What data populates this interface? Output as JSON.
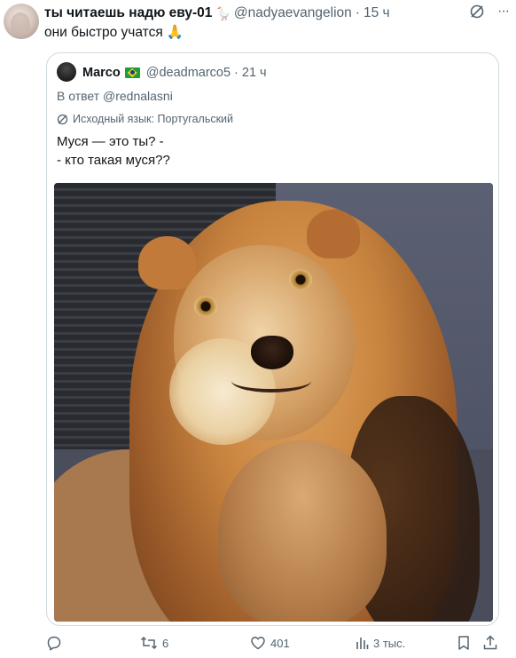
{
  "tweet": {
    "display_name": "ты читаешь надю еву-01",
    "name_emoji": "🪿",
    "handle": "@nadyaevangelion",
    "separator": "·",
    "time": "15 ч",
    "text": "они быстро учатся",
    "text_emoji": "🙏",
    "header_icons": [
      "grok-icon",
      "more-icon"
    ],
    "more_label": "···"
  },
  "quote": {
    "display_name": "Marco",
    "flag": "brazil-flag-icon",
    "handle": "@deadmarco5",
    "separator": "·",
    "time": "21 ч",
    "reply_to": "В ответ @rednalasni",
    "translation_note": "Исходный язык: Португальский",
    "text_lines": [
      "Муся — это ты? -",
      "- кто такая муся??"
    ],
    "media": "lion-photo"
  },
  "actions": {
    "reply": {
      "icon": "reply-icon",
      "count": ""
    },
    "retweet": {
      "icon": "retweet-icon",
      "count": "6"
    },
    "like": {
      "icon": "heart-icon",
      "count": "401"
    },
    "views": {
      "icon": "views-icon",
      "count": "3 тыс."
    },
    "bookmark": {
      "icon": "bookmark-icon"
    },
    "share": {
      "icon": "share-icon"
    }
  },
  "colors": {
    "text_primary": "#0f1419",
    "text_secondary": "#536471",
    "border": "#cfd9de"
  }
}
